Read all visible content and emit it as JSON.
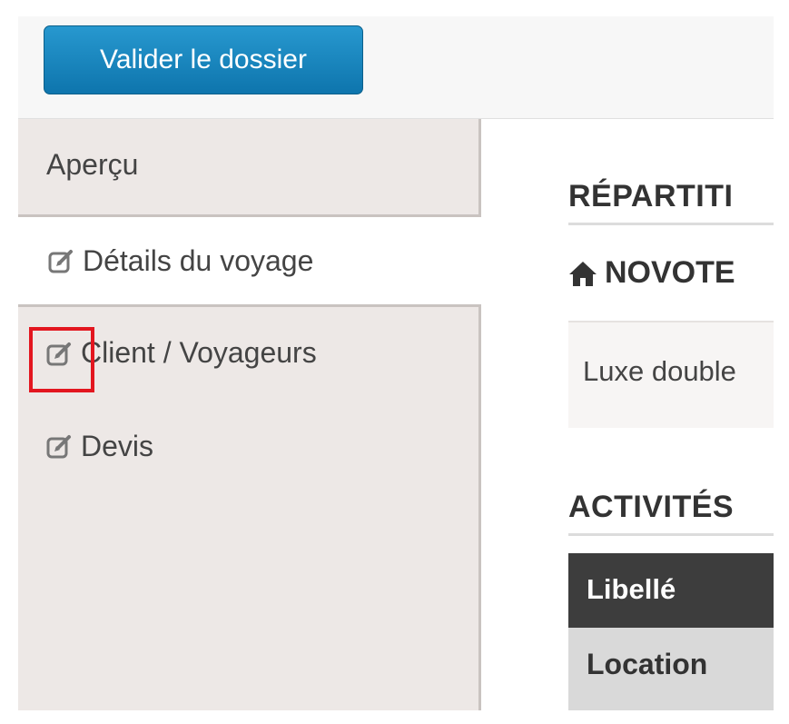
{
  "toolbar": {
    "validate_label": "Valider le dossier"
  },
  "sidebar": {
    "items": [
      {
        "label": "Aperçu"
      },
      {
        "label": "Détails du voyage"
      },
      {
        "label": "Client / Voyageurs"
      },
      {
        "label": "Devis"
      }
    ]
  },
  "main": {
    "repartition_heading": "RÉPARTITI",
    "hotel_name": "NOVOTE",
    "room_type": "Luxe double",
    "activities_heading": "ACTIVITÉS",
    "table": {
      "header": "Libellé",
      "rows": [
        "Location"
      ]
    }
  },
  "icons": {
    "edit": "edit-icon",
    "home": "home-icon"
  },
  "colors": {
    "button": "#0e75ad",
    "sidebar_bg": "#ede8e6",
    "highlight": "#e3161f",
    "table_header": "#3d3d3d"
  }
}
